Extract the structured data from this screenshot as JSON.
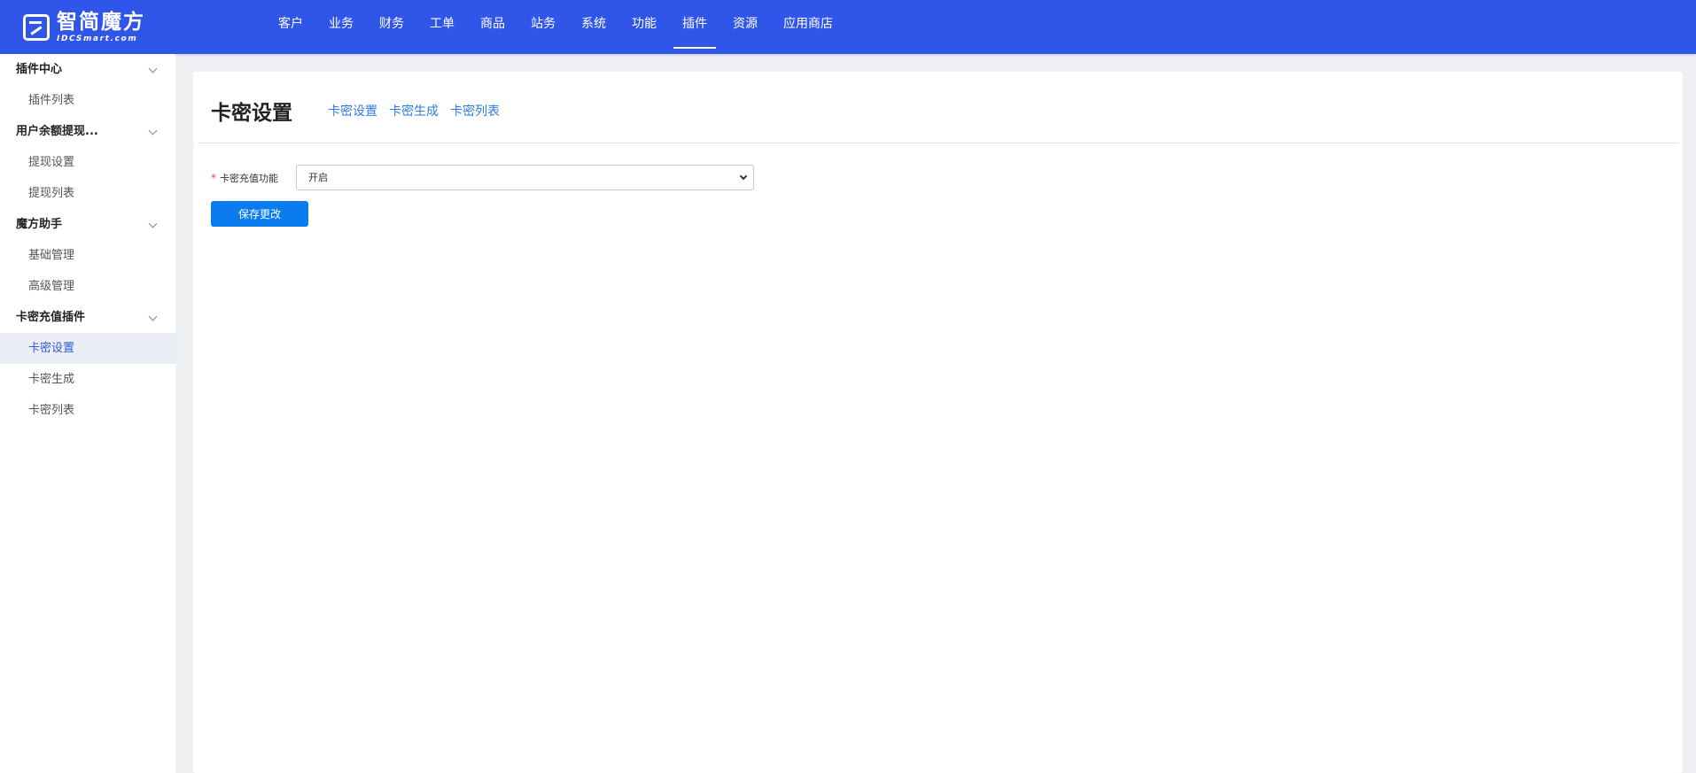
{
  "brand": {
    "name": "智简魔方",
    "subtitle": "IDCSmart.com"
  },
  "nav": [
    {
      "label": "客户",
      "active": false
    },
    {
      "label": "业务",
      "active": false
    },
    {
      "label": "财务",
      "active": false
    },
    {
      "label": "工单",
      "active": false
    },
    {
      "label": "商品",
      "active": false
    },
    {
      "label": "站务",
      "active": false
    },
    {
      "label": "系统",
      "active": false
    },
    {
      "label": "功能",
      "active": false
    },
    {
      "label": "插件",
      "active": true
    },
    {
      "label": "资源",
      "active": false
    },
    {
      "label": "应用商店",
      "active": false
    }
  ],
  "sidebar": {
    "groups": [
      {
        "title": "插件中心",
        "items": [
          {
            "label": "插件列表",
            "active": false
          }
        ]
      },
      {
        "title": "用户余额提现...",
        "items": [
          {
            "label": "提现设置",
            "active": false
          },
          {
            "label": "提现列表",
            "active": false
          }
        ]
      },
      {
        "title": "魔方助手",
        "items": [
          {
            "label": "基础管理",
            "active": false
          },
          {
            "label": "高级管理",
            "active": false
          }
        ]
      },
      {
        "title": "卡密充值插件",
        "items": [
          {
            "label": "卡密设置",
            "active": true
          },
          {
            "label": "卡密生成",
            "active": false
          },
          {
            "label": "卡密列表",
            "active": false
          }
        ]
      }
    ]
  },
  "page": {
    "title": "卡密设置",
    "tabs": [
      "卡密设置",
      "卡密生成",
      "卡密列表"
    ],
    "form": {
      "required_mark": "*",
      "label": "卡密充值功能",
      "value": "开启"
    },
    "save_label": "保存更改"
  },
  "colors": {
    "topbar": "#3056e9",
    "link": "#2c7be5",
    "primary_button": "#0b7cf0",
    "sidebar_active_bg": "#eceef5"
  }
}
